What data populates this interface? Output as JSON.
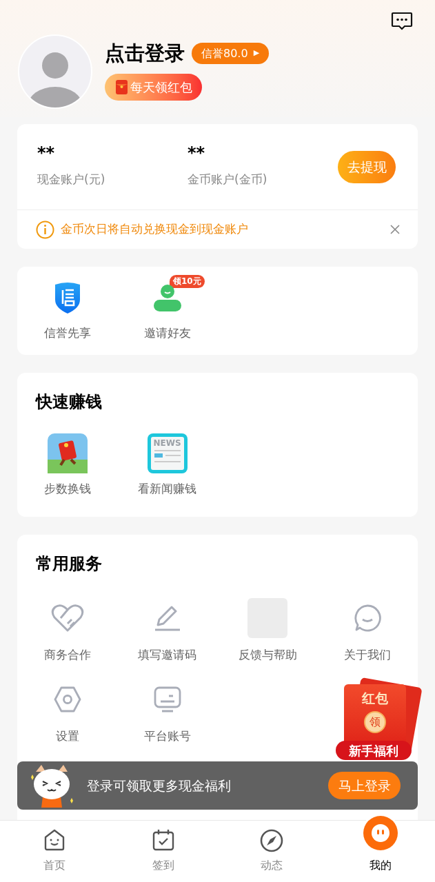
{
  "profile": {
    "login_text": "点击登录",
    "credit_badge": "信誉80.0",
    "credit_arrow": "▶",
    "red_packet_tip": "每天领红包"
  },
  "account": {
    "balances": [
      {
        "value": "**",
        "label": "现金账户(元)"
      },
      {
        "value": "**",
        "label": "金币账户(金币)"
      }
    ],
    "withdraw_button": "去提现",
    "notice": "金币次日将自动兑换现金到现金账户"
  },
  "shortcuts": [
    {
      "kind": "shield",
      "label": "信誉先享"
    },
    {
      "kind": "person",
      "label": "邀请好友",
      "badge": "领10元"
    }
  ],
  "quick_earn": {
    "title": "快速赚钱",
    "items": [
      {
        "kind": "steps",
        "label": "步数换钱"
      },
      {
        "kind": "news",
        "label": "看新闻赚钱",
        "icon_text": "NEWS"
      }
    ]
  },
  "services": {
    "title": "常用服务",
    "items": [
      {
        "kind": "heart",
        "label": "商务合作"
      },
      {
        "kind": "pencil",
        "label": "填写邀请码"
      },
      {
        "kind": "blank",
        "label": "反馈与帮助"
      },
      {
        "kind": "chat",
        "label": "关于我们"
      },
      {
        "kind": "gear",
        "label": "设置"
      },
      {
        "kind": "screen",
        "label": "平台账号"
      }
    ]
  },
  "floating_red_packet": {
    "title": "红包",
    "seal": "领",
    "caption": "新手福利"
  },
  "login_banner": {
    "text": "登录可领取更多现金福利",
    "button": "马上登录"
  },
  "bottom_nav": [
    {
      "kind": "home",
      "label": "首页",
      "selected": false
    },
    {
      "kind": "calendar",
      "label": "签到",
      "selected": false
    },
    {
      "kind": "compass",
      "label": "动态",
      "selected": false
    },
    {
      "kind": "face",
      "label": "我的",
      "selected": true
    }
  ]
}
